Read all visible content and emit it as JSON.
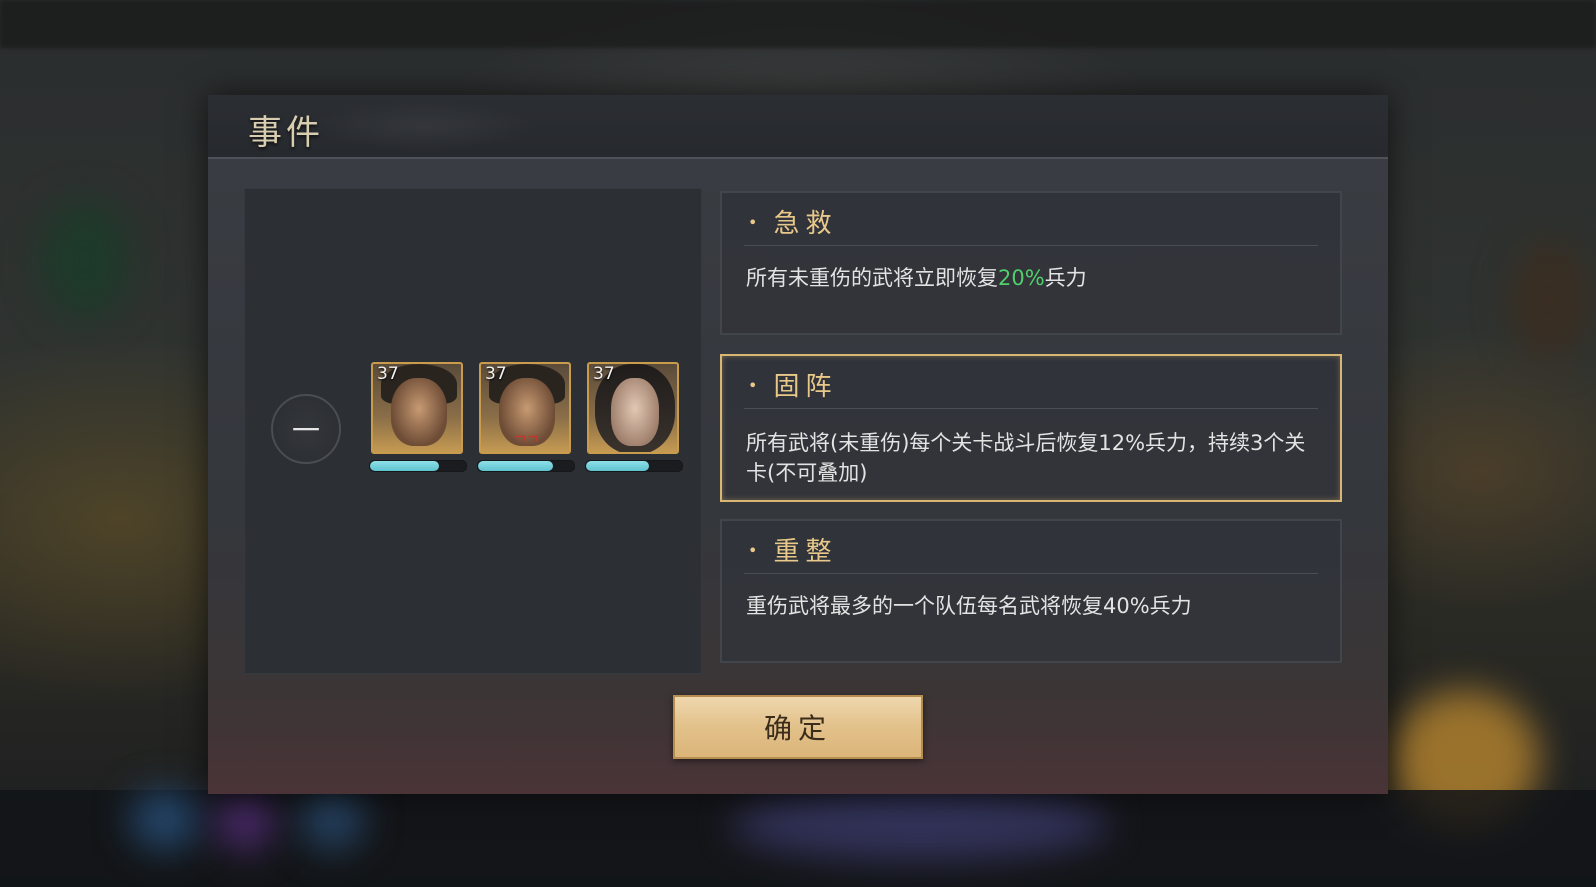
{
  "dialog": {
    "title": "事件"
  },
  "team": {
    "badge": "一",
    "heroes": [
      {
        "level": "37",
        "hp": 0.72,
        "emblem": ""
      },
      {
        "level": "37",
        "hp": 0.78,
        "emblem": "ᄀᄀ"
      },
      {
        "level": "37",
        "hp": 0.66,
        "emblem": ""
      }
    ]
  },
  "options": [
    {
      "title": "急救",
      "desc_pre": "所有未重伤的武将立即恢复",
      "desc_highlight": "20%",
      "desc_post": "兵力",
      "selected": false
    },
    {
      "title": "固阵",
      "desc": "所有武将(未重伤)每个关卡战斗后恢复12%兵力，持续3个关卡(不可叠加)",
      "selected": true
    },
    {
      "title": "重整",
      "desc": "重伤武将最多的一个队伍每名武将恢复40%兵力",
      "selected": false
    }
  ],
  "confirm_label": "确定",
  "colors": {
    "accent_gold": "#d8b775",
    "highlight_green": "#4fd06a",
    "hp_cyan": "#5fc3cf"
  }
}
